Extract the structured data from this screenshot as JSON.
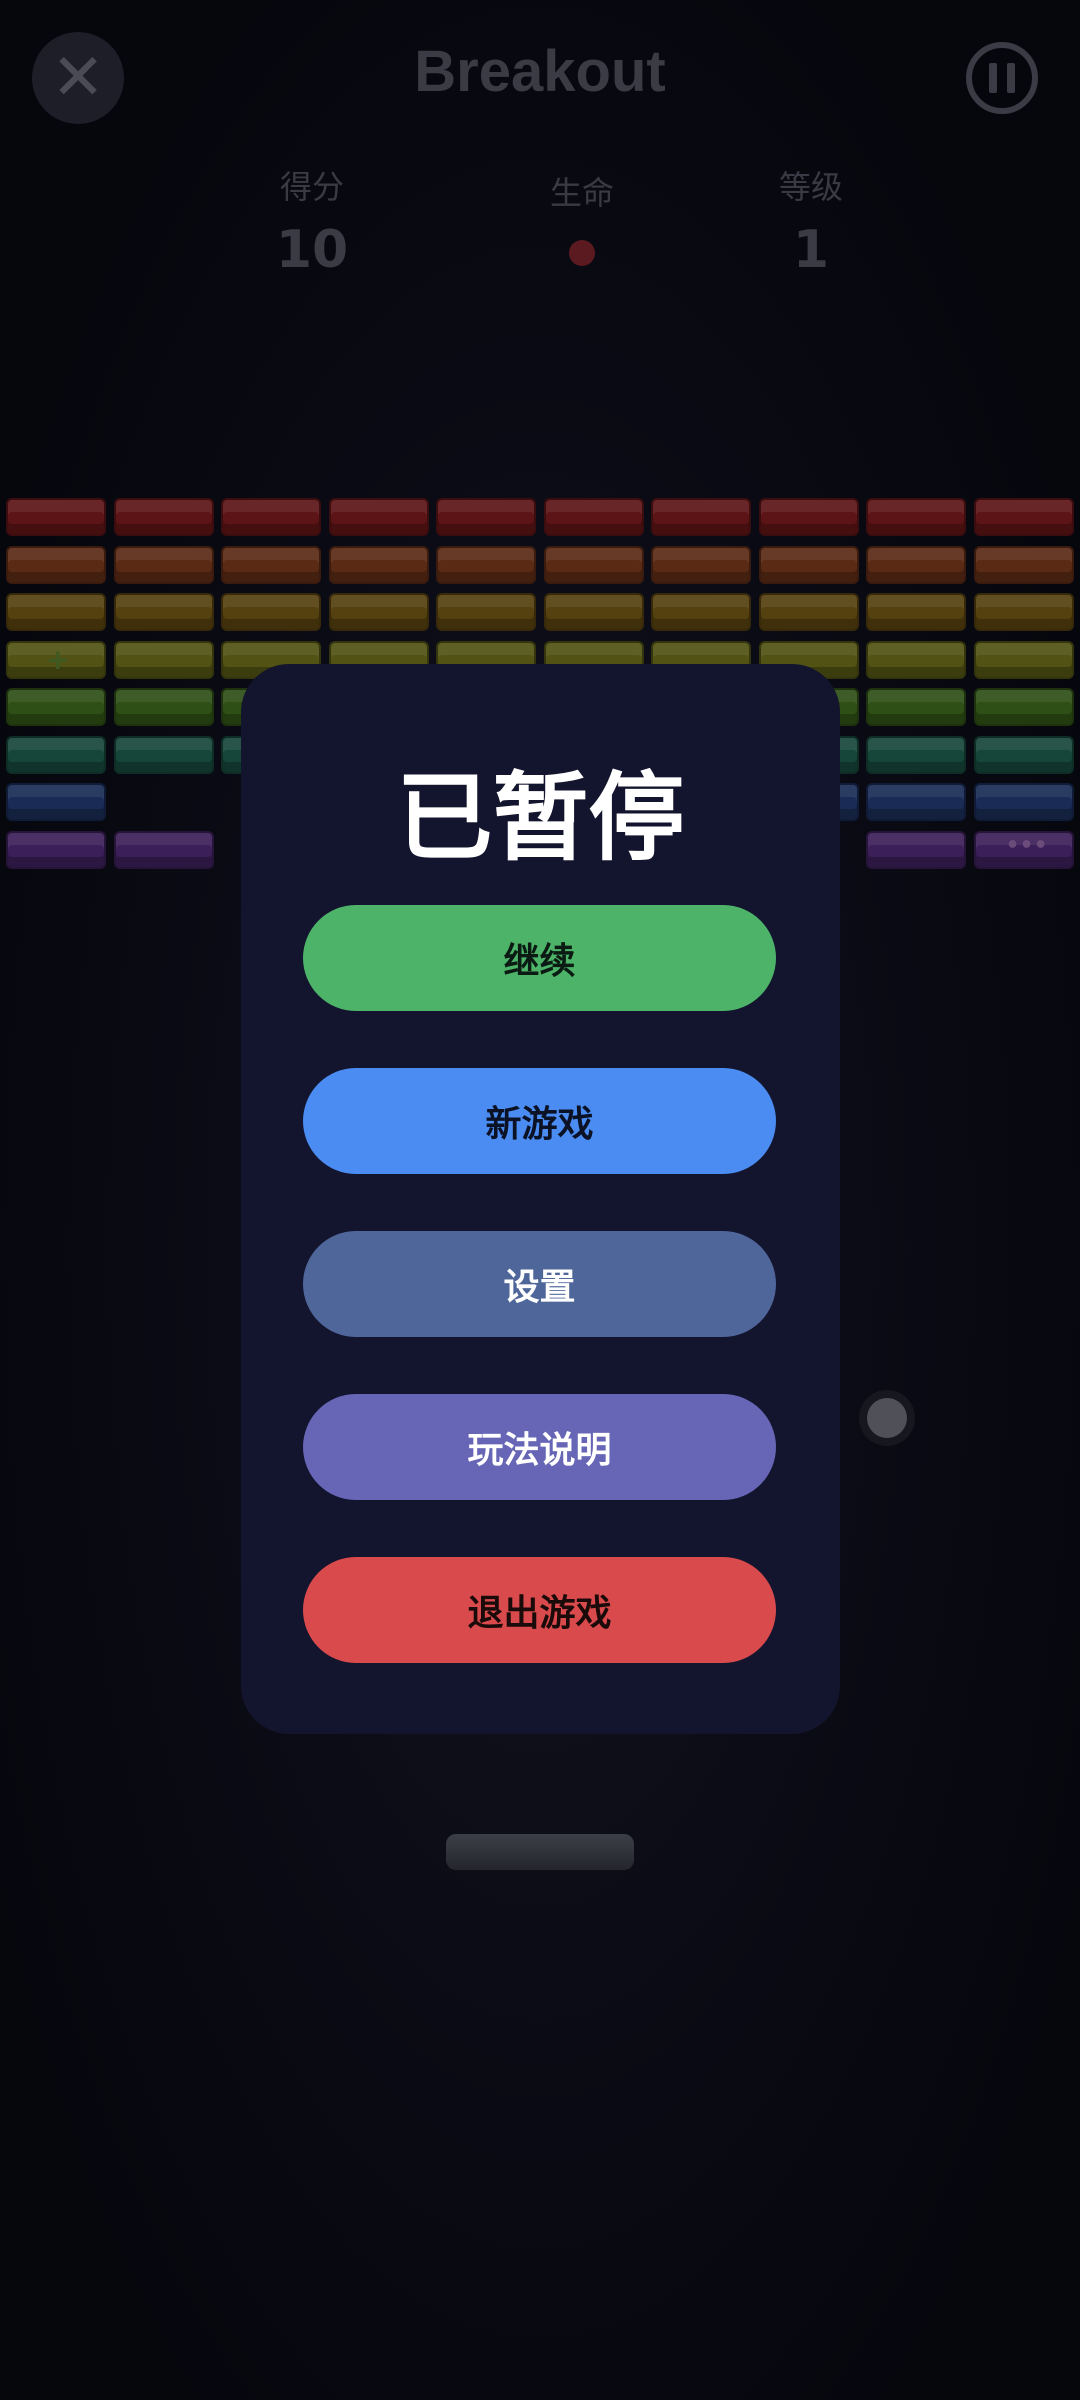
{
  "header": {
    "title": "Breakout",
    "close_icon": "close-icon",
    "pause_icon": "pause-icon"
  },
  "stats": {
    "score_label": "得分",
    "score_value": "10",
    "lives_label": "生命",
    "lives_count": 1,
    "level_label": "等级",
    "level_value": "1"
  },
  "bricks": {
    "row_colors": [
      "#5c1416",
      "#5a2a14",
      "#55400f",
      "#515213",
      "#2e4f15",
      "#16463a",
      "#1a2c55",
      "#3b1f58"
    ],
    "rows": [
      [
        1,
        1,
        1,
        1,
        1,
        1,
        1,
        1,
        1,
        1
      ],
      [
        1,
        1,
        1,
        1,
        1,
        1,
        1,
        1,
        1,
        1
      ],
      [
        1,
        1,
        1,
        1,
        1,
        1,
        1,
        1,
        1,
        1
      ],
      [
        1,
        1,
        1,
        1,
        1,
        1,
        1,
        1,
        1,
        1
      ],
      [
        1,
        1,
        1,
        1,
        1,
        1,
        1,
        1,
        1,
        1
      ],
      [
        1,
        1,
        1,
        1,
        1,
        1,
        1,
        1,
        1,
        1
      ],
      [
        1,
        0,
        0,
        0,
        0,
        0,
        0,
        1,
        1,
        1
      ],
      [
        1,
        1,
        0,
        0,
        0,
        0,
        0,
        0,
        1,
        1
      ]
    ],
    "powerup_marks": [
      {
        "row": 3,
        "col": 0,
        "symbol": "+"
      },
      {
        "row": 7,
        "col": 9,
        "symbol": "•••"
      }
    ]
  },
  "pause_menu": {
    "title": "已暂停",
    "buttons": [
      {
        "label": "继续",
        "name": "resume-button",
        "color": "#4cb369",
        "text_color": "#0b1a12"
      },
      {
        "label": "新游戏",
        "name": "new-game-button",
        "color": "#4a8cf1",
        "text_color": "#0b1226"
      },
      {
        "label": "设置",
        "name": "settings-button",
        "color": "#4f669a",
        "text_color": "#ffffff"
      },
      {
        "label": "玩法说明",
        "name": "how-to-play-button",
        "color": "#6766b6",
        "text_color": "#ffffff"
      },
      {
        "label": "退出游戏",
        "name": "quit-game-button",
        "color": "#d94a4c",
        "text_color": "#1a0a0a"
      }
    ]
  }
}
